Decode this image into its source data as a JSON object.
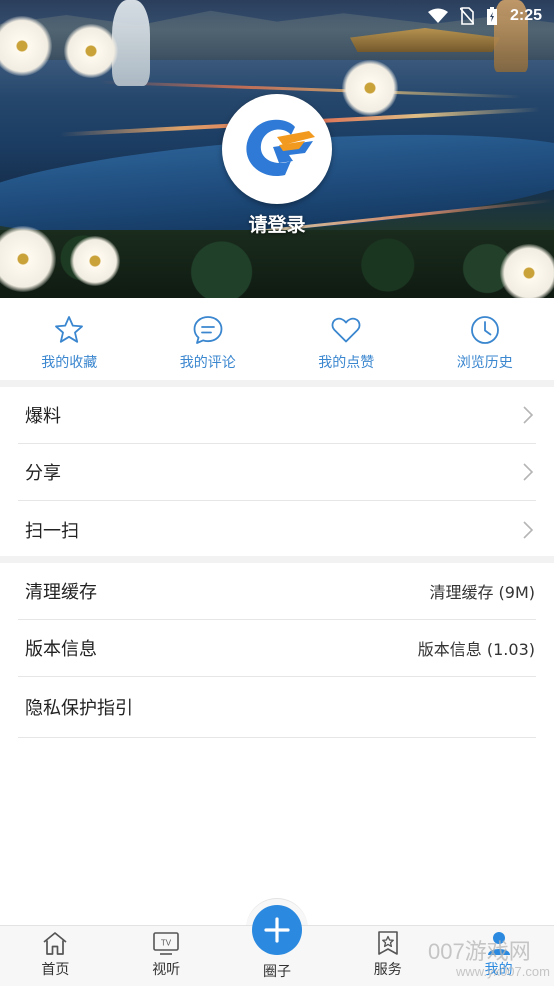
{
  "status_bar": {
    "time": "2:25",
    "icons": [
      "wifi-icon",
      "no-sim-icon",
      "battery-charging-icon"
    ]
  },
  "profile": {
    "login_prompt": "请登录",
    "logo_icon": "app-logo-icon",
    "colors": {
      "logo_blue": "#2e7ad6",
      "logo_orange": "#f29a1f"
    }
  },
  "quick_actions": [
    {
      "label": "我的收藏",
      "icon": "star-icon"
    },
    {
      "label": "我的评论",
      "icon": "comment-icon"
    },
    {
      "label": "我的点赞",
      "icon": "heart-icon"
    },
    {
      "label": "浏览历史",
      "icon": "clock-icon"
    }
  ],
  "menu_group_1": [
    {
      "label": "爆料"
    },
    {
      "label": "分享"
    },
    {
      "label": "扫一扫"
    }
  ],
  "menu_group_2": [
    {
      "label": "清理缓存",
      "value": "清理缓存 (9M)"
    },
    {
      "label": "版本信息",
      "value": "版本信息 (1.03)"
    },
    {
      "label": "隐私保护指引"
    }
  ],
  "bottom_nav": [
    {
      "label": "首页",
      "icon": "home-icon"
    },
    {
      "label": "视听",
      "icon": "tv-icon",
      "icon_text": "TV"
    },
    {
      "label": "圈子",
      "icon": "plus-icon"
    },
    {
      "label": "服务",
      "icon": "service-icon"
    },
    {
      "label": "我的",
      "icon": "user-icon"
    }
  ],
  "watermark": {
    "text": "007游戏网",
    "url": "www.yx007.com"
  },
  "colors": {
    "accent": "#3a86cf",
    "fab": "#2b8ae0"
  }
}
